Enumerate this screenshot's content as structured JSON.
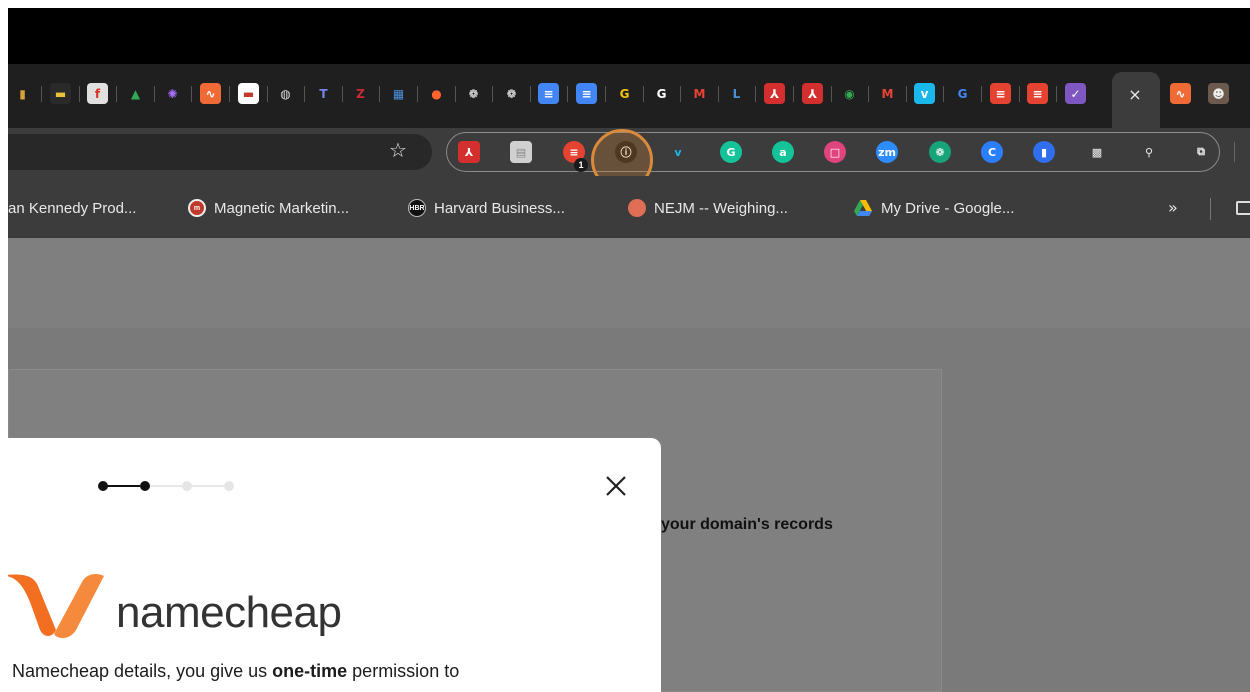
{
  "browser": {
    "tab_icons": [
      {
        "name": "shopping-icon",
        "bg": "#1f1f1f",
        "glyph": "▮",
        "color": "#d8a23a"
      },
      {
        "name": "toolbox-icon",
        "bg": "#2a2a2a",
        "glyph": "▬",
        "color": "#e8c23a"
      },
      {
        "name": "f-logo-icon",
        "bg": "#e0e0e0",
        "glyph": "f",
        "color": "#d9331e"
      },
      {
        "name": "google-drive-icon",
        "bg": "#1f1f1f",
        "glyph": "▲",
        "color": "#34a853"
      },
      {
        "name": "starburst-icon",
        "bg": "#1f1f1f",
        "glyph": "✺",
        "color": "#a970ff"
      },
      {
        "name": "analytics-icon",
        "bg": "#f06a36",
        "glyph": "∿",
        "color": "#ffffff"
      },
      {
        "name": "white-page-icon",
        "bg": "#ffffff",
        "glyph": "▬",
        "color": "#c0392b"
      },
      {
        "name": "globe-icon",
        "bg": "#1f1f1f",
        "glyph": "◍",
        "color": "#dddddd"
      },
      {
        "name": "teams-icon",
        "bg": "#1f1f1f",
        "glyph": "T",
        "color": "#7b83eb"
      },
      {
        "name": "zotero-icon",
        "bg": "#1f1f1f",
        "glyph": "Z",
        "color": "#cc2936"
      },
      {
        "name": "calculator-icon",
        "bg": "#1f1f1f",
        "glyph": "▦",
        "color": "#4a90d9"
      },
      {
        "name": "semrush-icon",
        "bg": "#1f1f1f",
        "glyph": "●",
        "color": "#ff642d"
      },
      {
        "name": "chatgpt-icon",
        "bg": "#1f1f1f",
        "glyph": "❁",
        "color": "#ffffff"
      },
      {
        "name": "chatgpt-icon",
        "bg": "#1f1f1f",
        "glyph": "❁",
        "color": "#ffffff"
      },
      {
        "name": "google-docs-icon",
        "bg": "#4285f4",
        "glyph": "≡",
        "color": "#ffffff"
      },
      {
        "name": "google-docs-icon",
        "bg": "#4285f4",
        "glyph": "≡",
        "color": "#ffffff"
      },
      {
        "name": "grammarly-g-icon",
        "bg": "#1f1f1f",
        "glyph": "G",
        "color": "#f4c20d"
      },
      {
        "name": "grammarly-g-icon",
        "bg": "#1f1f1f",
        "glyph": "G",
        "color": "#ffffff"
      },
      {
        "name": "gmail-icon",
        "bg": "#1f1f1f",
        "glyph": "M",
        "color": "#ea4335"
      },
      {
        "name": "l-letter-icon",
        "bg": "#1f1f1f",
        "glyph": "L",
        "color": "#4a90d9"
      },
      {
        "name": "acrobat-icon",
        "bg": "#d32f2f",
        "glyph": "⅄",
        "color": "#ffffff"
      },
      {
        "name": "acrobat-icon",
        "bg": "#d32f2f",
        "glyph": "⅄",
        "color": "#ffffff"
      },
      {
        "name": "chrome-icon",
        "bg": "#1f1f1f",
        "glyph": "◉",
        "color": "#34a853"
      },
      {
        "name": "gmail-icon",
        "bg": "#1f1f1f",
        "glyph": "M",
        "color": "#ea4335"
      },
      {
        "name": "vimeo-icon",
        "bg": "#1ab7ea",
        "glyph": "v",
        "color": "#ffffff"
      },
      {
        "name": "google-icon",
        "bg": "#1f1f1f",
        "glyph": "G",
        "color": "#4285f4"
      },
      {
        "name": "todoist-icon",
        "bg": "#e44332",
        "glyph": "≡",
        "color": "#ffffff"
      },
      {
        "name": "todoist-icon",
        "bg": "#e44332",
        "glyph": "≡",
        "color": "#ffffff"
      },
      {
        "name": "checklist-icon",
        "bg": "#7e57c2",
        "glyph": "✓",
        "color": "#ffffff"
      }
    ],
    "active_tab_close": "×",
    "after_tabs": [
      {
        "name": "analytics-icon",
        "bg": "#f06a36",
        "glyph": "∿",
        "color": "#ffffff"
      },
      {
        "name": "profile-photo-icon",
        "bg": "#6d5a4e",
        "glyph": "☻",
        "color": "#eeeeee"
      }
    ],
    "bookmark_star": "☆",
    "extensions": [
      {
        "name": "acrobat-extension-icon",
        "bg": "#d32f2f",
        "glyph": "⅄",
        "color": "#ffffff",
        "square": true
      },
      {
        "name": "document-extension-icon",
        "bg": "#d0d0d0",
        "glyph": "▤",
        "color": "#888888",
        "square": true
      },
      {
        "name": "todoist-extension-icon",
        "bg": "#e44332",
        "glyph": "≡",
        "color": "#ffffff",
        "square": false
      },
      {
        "name": "onepassword-extension-icon",
        "bg": "#1a1a1a",
        "glyph": "ⓘ",
        "color": "#ffffff",
        "square": false
      },
      {
        "name": "vimeo-extension-icon",
        "bg": "#3c3c3c",
        "glyph": "v",
        "color": "#1ab7ea",
        "square": false
      },
      {
        "name": "grammarly-extension-icon",
        "bg": "#15c39a",
        "glyph": "G",
        "color": "#ffffff",
        "square": false
      },
      {
        "name": "a-extension-icon",
        "bg": "#15c39a",
        "glyph": "a",
        "color": "#ffffff",
        "square": false
      },
      {
        "name": "pink-square-extension-icon",
        "bg": "#e0447c",
        "glyph": "□",
        "color": "#ffffff",
        "square": false
      },
      {
        "name": "zoom-extension-icon",
        "bg": "#2d8cff",
        "glyph": "zm",
        "color": "#ffffff",
        "square": false
      },
      {
        "name": "chatgpt-extension-icon",
        "bg": "#19a37a",
        "glyph": "❁",
        "color": "#ffffff",
        "square": false
      },
      {
        "name": "c-extension-icon",
        "bg": "#2a7fff",
        "glyph": "C",
        "color": "#ffffff",
        "square": false
      },
      {
        "name": "bookmark-extension-icon",
        "bg": "#2f6fed",
        "glyph": "▮",
        "color": "#ffffff",
        "square": false
      },
      {
        "name": "qr-code-extension-icon",
        "bg": "#3c3c3c",
        "glyph": "▩",
        "color": "#eeeeee",
        "square": true
      },
      {
        "name": "search-icon",
        "bg": "#3c3c3c",
        "glyph": "⚲",
        "color": "#eeeeee",
        "square": false
      },
      {
        "name": "puzzle-extensions-icon",
        "bg": "#3c3c3c",
        "glyph": "⧉",
        "color": "#eeeeee",
        "square": false
      }
    ],
    "extension_badge": "1",
    "bookmarks": [
      {
        "label": "an Kennedy Prod...",
        "icon": "",
        "icon_bg": ""
      },
      {
        "label": "Magnetic Marketin...",
        "icon": "m",
        "icon_bg": "#c0392b"
      },
      {
        "label": "Harvard Business...",
        "icon": "HBR",
        "icon_bg": "#111111"
      },
      {
        "label": "NEJM -- Weighing...",
        "icon": "",
        "icon_bg": "#e06d55"
      },
      {
        "label": "My Drive - Google...",
        "icon": "",
        "icon_bg": "#34a853"
      }
    ],
    "bookmarks_more": "»"
  },
  "page": {
    "background_heading": "your domain's records"
  },
  "modal": {
    "steps_total": 4,
    "steps_completed": 2,
    "brand_name": "namecheap",
    "text_before": "Namecheap details, you give us ",
    "text_bold": "one-time",
    "text_after": " permission to",
    "accent_color": "#f26e21"
  }
}
